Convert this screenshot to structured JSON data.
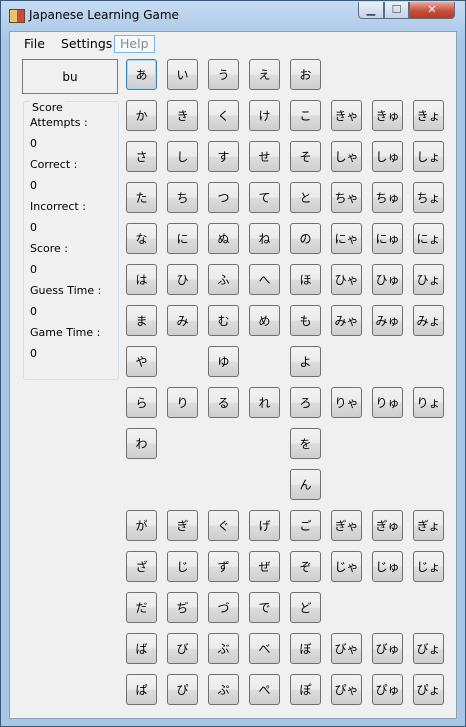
{
  "window": {
    "title": "Japanese Learning Game",
    "minimize_glyph": "▁",
    "maximize_glyph": "☐",
    "close_glyph": "✕"
  },
  "menu": {
    "file": "File",
    "settings": "Settings",
    "help": "Help"
  },
  "prompt": {
    "romaji": "bu"
  },
  "score": {
    "group_title": "Score",
    "attempts_label": "Attempts :",
    "attempts_value": "0",
    "correct_label": "Correct :",
    "correct_value": "0",
    "incorrect_label": "Incorrect :",
    "incorrect_value": "0",
    "score_label": "Score :",
    "score_value": "0",
    "guess_time_label": "Guess Time :",
    "guess_time_value": "0",
    "game_time_label": "Game Time :",
    "game_time_value": "0"
  },
  "kana_rows": [
    [
      "あ",
      "い",
      "う",
      "え",
      "お",
      "",
      "",
      ""
    ],
    [
      "か",
      "き",
      "く",
      "け",
      "こ",
      "きゃ",
      "きゅ",
      "きょ"
    ],
    [
      "さ",
      "し",
      "す",
      "せ",
      "そ",
      "しゃ",
      "しゅ",
      "しょ"
    ],
    [
      "た",
      "ち",
      "つ",
      "て",
      "と",
      "ちゃ",
      "ちゅ",
      "ちょ"
    ],
    [
      "な",
      "に",
      "ぬ",
      "ね",
      "の",
      "にゃ",
      "にゅ",
      "にょ"
    ],
    [
      "は",
      "ひ",
      "ふ",
      "へ",
      "ほ",
      "ひゃ",
      "ひゅ",
      "ひょ"
    ],
    [
      "ま",
      "み",
      "む",
      "め",
      "も",
      "みゃ",
      "みゅ",
      "みょ"
    ],
    [
      "や",
      "",
      "ゆ",
      "",
      "よ",
      "",
      "",
      ""
    ],
    [
      "ら",
      "り",
      "る",
      "れ",
      "ろ",
      "りゃ",
      "りゅ",
      "りょ"
    ],
    [
      "わ",
      "",
      "",
      "",
      "を",
      "",
      "",
      ""
    ],
    [
      "",
      "",
      "",
      "",
      "ん",
      "",
      "",
      ""
    ],
    [
      "が",
      "ぎ",
      "ぐ",
      "げ",
      "ご",
      "ぎゃ",
      "ぎゅ",
      "ぎょ"
    ],
    [
      "ざ",
      "じ",
      "ず",
      "ぜ",
      "ぞ",
      "じゃ",
      "じゅ",
      "じょ"
    ],
    [
      "だ",
      "ぢ",
      "づ",
      "で",
      "ど",
      "",
      "",
      ""
    ],
    [
      "ば",
      "び",
      "ぶ",
      "べ",
      "ぼ",
      "びゃ",
      "びゅ",
      "びょ"
    ],
    [
      "ぱ",
      "ぴ",
      "ぷ",
      "ぺ",
      "ぽ",
      "ぴゃ",
      "ぴゅ",
      "ぴょ"
    ]
  ]
}
